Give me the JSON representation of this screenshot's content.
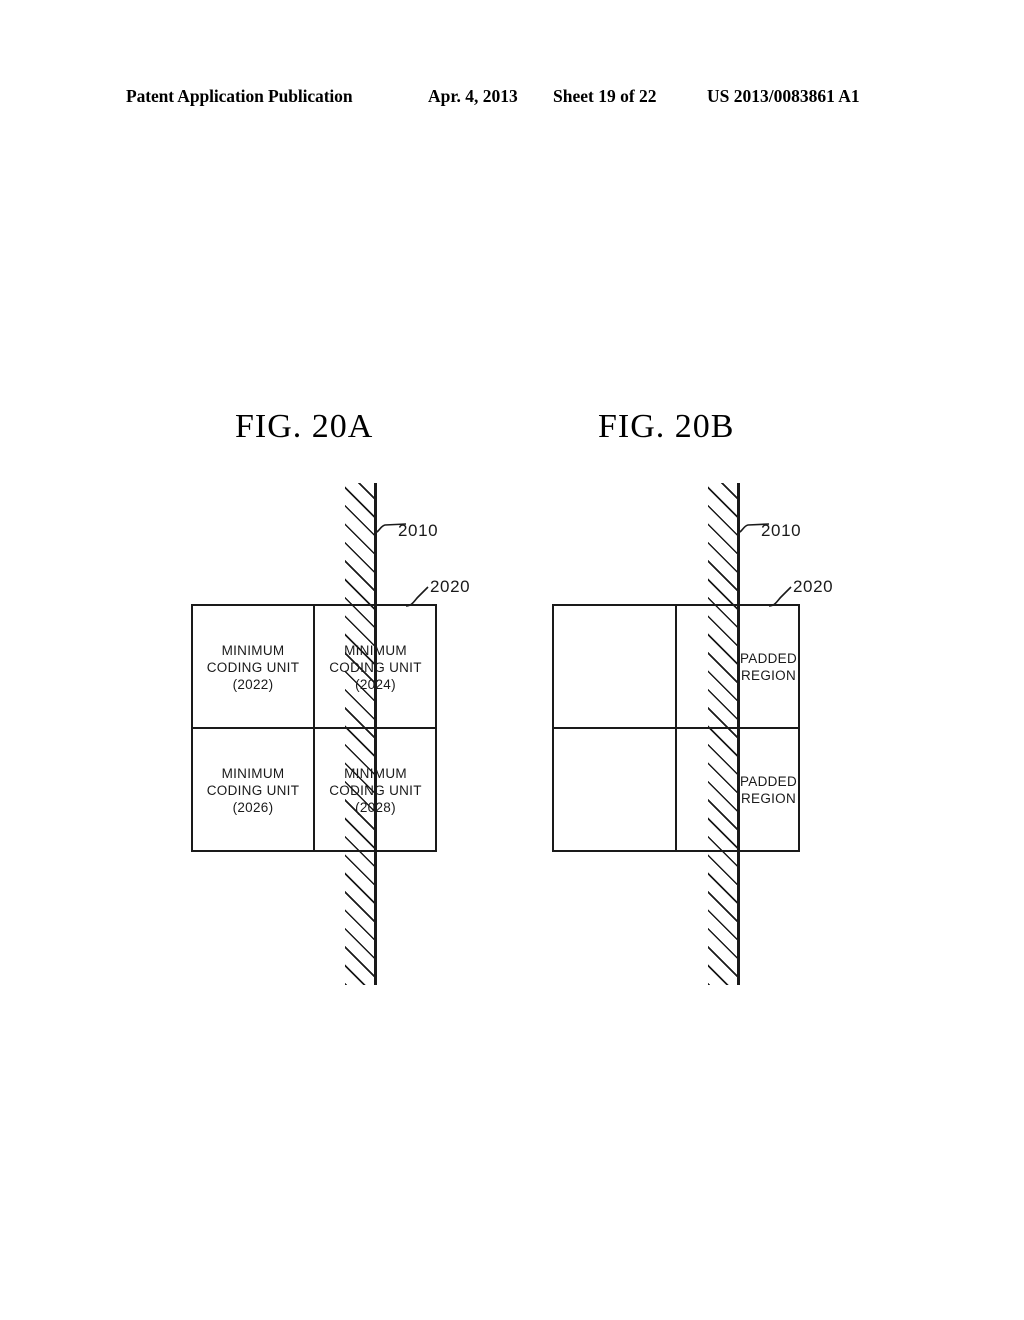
{
  "header": {
    "publication": "Patent Application Publication",
    "date": "Apr. 4, 2013",
    "sheet": "Sheet 19 of 22",
    "doc_number": "US 2013/0083861 A1"
  },
  "figures": [
    {
      "id": "fig-20a",
      "title": "FIG. 20A",
      "boundary_label": "2010",
      "block_label": "2020",
      "cells": [
        {
          "id": "cell-2022",
          "line1": "MINIMUM",
          "line2": "CODING UNIT",
          "line3": "(2022)"
        },
        {
          "id": "cell-2024",
          "line1": "MINIMUM",
          "line2": "CODING UNIT",
          "line3": "(2024)"
        },
        {
          "id": "cell-2026",
          "line1": "MINIMUM",
          "line2": "CODING UNIT",
          "line3": "(2026)"
        },
        {
          "id": "cell-2028",
          "line1": "MINIMUM",
          "line2": "CODING UNIT",
          "line3": "(2028)"
        }
      ]
    },
    {
      "id": "fig-20b",
      "title": "FIG. 20B",
      "boundary_label": "2010",
      "block_label": "2020",
      "cells": [
        {
          "id": "cell-empty-tl",
          "line1": "",
          "line2": "",
          "line3": ""
        },
        {
          "id": "cell-empty-bl",
          "line1": "",
          "line2": "",
          "line3": ""
        },
        {
          "id": "cell-padded-top",
          "line1": "PADDED",
          "line2": "REGION",
          "line3": ""
        },
        {
          "id": "cell-padded-bottom",
          "line1": "PADDED",
          "line2": "REGION",
          "line3": ""
        }
      ]
    }
  ],
  "colors": {
    "ink": "#1a1a1a",
    "paper": "#ffffff"
  }
}
